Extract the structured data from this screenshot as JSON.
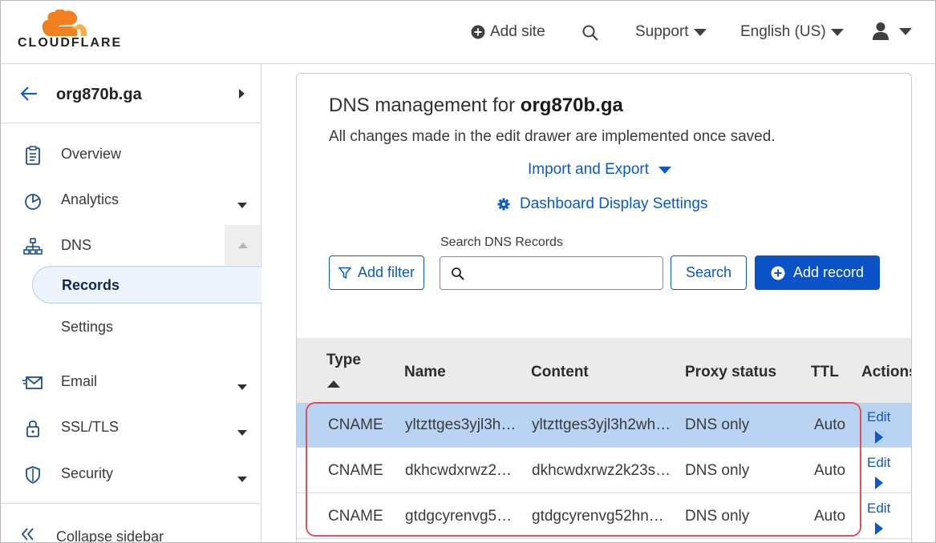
{
  "header": {
    "logo_text": "CLOUDFLARE",
    "add_site": "Add site",
    "support": "Support",
    "language": "English (US)"
  },
  "sidebar": {
    "zone": "org870b.ga",
    "items": [
      {
        "label": "Overview",
        "icon": "clipboard-icon"
      },
      {
        "label": "Analytics",
        "icon": "pie-chart-icon"
      },
      {
        "label": "DNS",
        "icon": "network-icon"
      },
      {
        "label": "Records"
      },
      {
        "label": "Settings"
      },
      {
        "label": "Email",
        "icon": "envelope-icon"
      },
      {
        "label": "SSL/TLS",
        "icon": "lock-icon"
      },
      {
        "label": "Security",
        "icon": "shield-icon"
      }
    ],
    "collapse": "Collapse sidebar"
  },
  "main": {
    "title_prefix": "DNS management for ",
    "title_domain": "org870b.ga",
    "subtitle": "All changes made in the edit drawer are implemented once saved.",
    "import_export": "Import and Export",
    "dashboard_settings": "Dashboard Display Settings",
    "search_label": "Search DNS Records",
    "search_placeholder": "",
    "add_filter": "Add filter",
    "search_button": "Search",
    "add_record": "Add record"
  },
  "table": {
    "columns": [
      "Type",
      "Name",
      "Content",
      "Proxy status",
      "TTL",
      "Actions"
    ],
    "rows": [
      {
        "type": "CNAME",
        "name": "yltzttges3yjl3h…",
        "content": "yltzttges3yjl3h2wh…",
        "proxy": "DNS only",
        "ttl": "Auto",
        "action": "Edit"
      },
      {
        "type": "CNAME",
        "name": "dkhcwdxrwz2…",
        "content": "dkhcwdxrwz2k23s…",
        "proxy": "DNS only",
        "ttl": "Auto",
        "action": "Edit"
      },
      {
        "type": "CNAME",
        "name": "gtdgcyrenvg5…",
        "content": "gtdgcyrenvg52hn…",
        "proxy": "DNS only",
        "ttl": "Auto",
        "action": "Edit"
      }
    ]
  },
  "colors": {
    "accent": "#0a52c6",
    "link": "#0a58ca",
    "brand_orange": "#f38020",
    "selected_row": "#b9d3f3",
    "highlight": "#e0525a"
  }
}
